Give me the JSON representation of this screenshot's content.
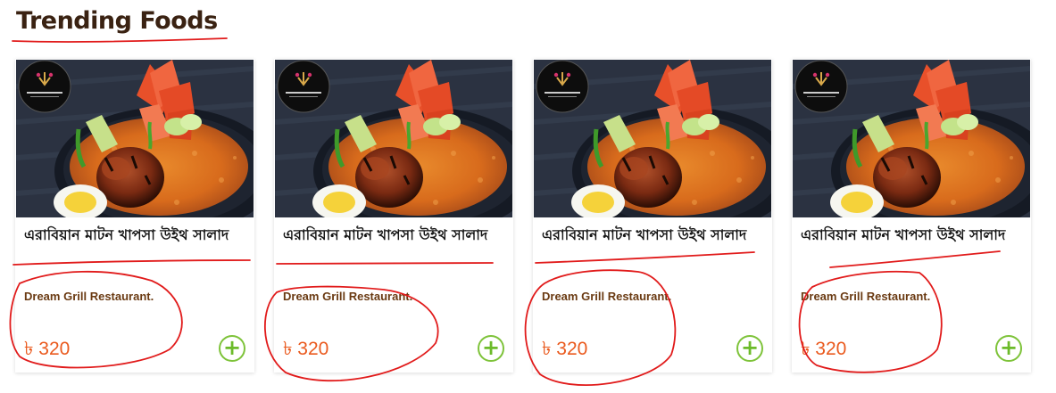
{
  "section": {
    "title": "Trending Foods"
  },
  "colors": {
    "title": "#3a2212",
    "price": "#ea5a1e",
    "restaurant": "#6a3a12",
    "add_button": "#7ec33a",
    "annotation": "#e11b1b"
  },
  "cards": [
    {
      "name": "এরাবিয়ান মাটন খাপসা উইথ সালাদ",
      "restaurant": "Dream Grill Restaurant.",
      "price": "৳ 320",
      "add_icon": "plus-icon",
      "add_symbol": "+"
    },
    {
      "name": "এরাবিয়ান মাটন খাপসা উইথ সালাদ",
      "restaurant": "Dream Grill Restaurant.",
      "price": "৳ 320",
      "add_icon": "plus-icon",
      "add_symbol": "+"
    },
    {
      "name": "এরাবিয়ান মাটন খাপসা উইথ সালাদ",
      "restaurant": "Dream Grill Restaurant.",
      "price": "৳ 320",
      "add_icon": "plus-icon",
      "add_symbol": "+"
    },
    {
      "name": "এরাবিয়ান মাটন খাপসা উইথ সালাদ",
      "restaurant": "Dream Grill Restaurant.",
      "price": "৳ 320",
      "add_icon": "plus-icon",
      "add_symbol": "+"
    }
  ]
}
